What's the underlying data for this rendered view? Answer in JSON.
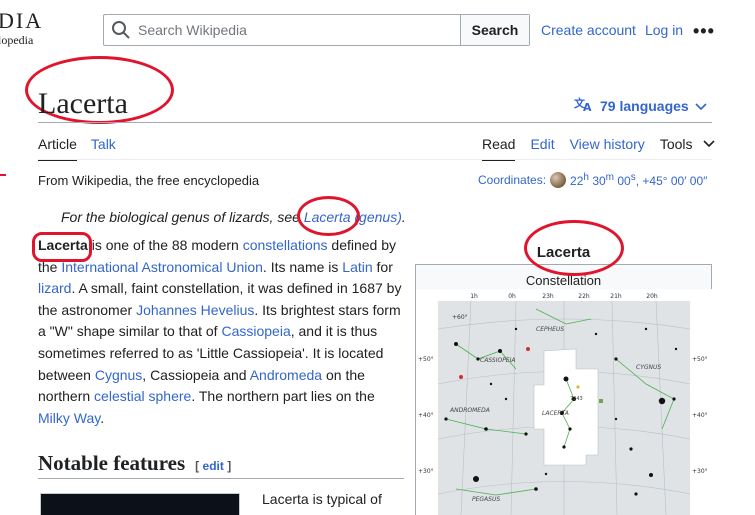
{
  "site": {
    "logo_text": "DIA",
    "logo_subtitle": "lopedia"
  },
  "search": {
    "placeholder": "Search Wikipedia",
    "button": "Search"
  },
  "header": {
    "create_account": "Create account",
    "log_in": "Log in",
    "more": "•••"
  },
  "article": {
    "title": "Lacerta",
    "languages": "79 languages",
    "tabs_left": [
      "Article",
      "Talk"
    ],
    "tabs_right": [
      "Read",
      "Edit",
      "View history",
      "Tools"
    ],
    "tagline": "From Wikipedia, the free encyclopedia",
    "coordinates": {
      "label": "Coordinates:",
      "ra_h": "22",
      "ra_m": "30",
      "ra_s": "00",
      "dec": ", +45° 00′ 00″"
    },
    "hatnote": {
      "prefix": "For the biological genus of lizards, see ",
      "link": "Lacerta (genus)",
      "suffix": "."
    },
    "lead": {
      "bold": "Lacerta",
      "t1": " is one of the 88 modern ",
      "l1": "constellations",
      "t2": " defined by the ",
      "l2": "International Astronomical Union",
      "t3": ". Its name is ",
      "l3": "Latin",
      "t4": " for ",
      "l4": "lizard",
      "t5": ". A small, faint constellation, it was defined in 1687 by the astronomer ",
      "l5": "Johannes Hevelius",
      "t6": ". Its brightest stars form a \"W\" shape similar to that of ",
      "l6": "Cassiopeia",
      "t7": ", and it is thus sometimes referred to as 'Little Cassiopeia'. It is located between ",
      "l7": "Cygnus",
      "t8": ", Cassiopeia and ",
      "l8": "Andromeda",
      "t9": " on the northern ",
      "l9": "celestial sphere",
      "t10": ". The northern part lies on the ",
      "l10": "Milky Way",
      "t11": "."
    },
    "section": {
      "title": "Notable features",
      "edit": "edit"
    },
    "section_text": "Lacerta is typical of"
  },
  "infobox": {
    "title": "Lacerta",
    "caption": "Constellation",
    "ra_ticks": [
      "1h",
      "0h",
      "23h",
      "22h",
      "21h",
      "20h"
    ],
    "dec_ticks": [
      "+50°",
      "+40°",
      "+30°"
    ],
    "dec_ticks_top": "+60°",
    "labels": {
      "cepheus": "CEPHEUS",
      "cassiopeia": "CASSIOPEIA",
      "cygnus": "CYGNUS",
      "andromeda": "ANDROMEDA",
      "lacerta": "LACERTA",
      "pegasus": "PEGASUS",
      "ngc": "7243"
    }
  },
  "colors": {
    "link": "#3366cc",
    "annotation": "#e0142d",
    "rule": "#a2a9b1"
  }
}
